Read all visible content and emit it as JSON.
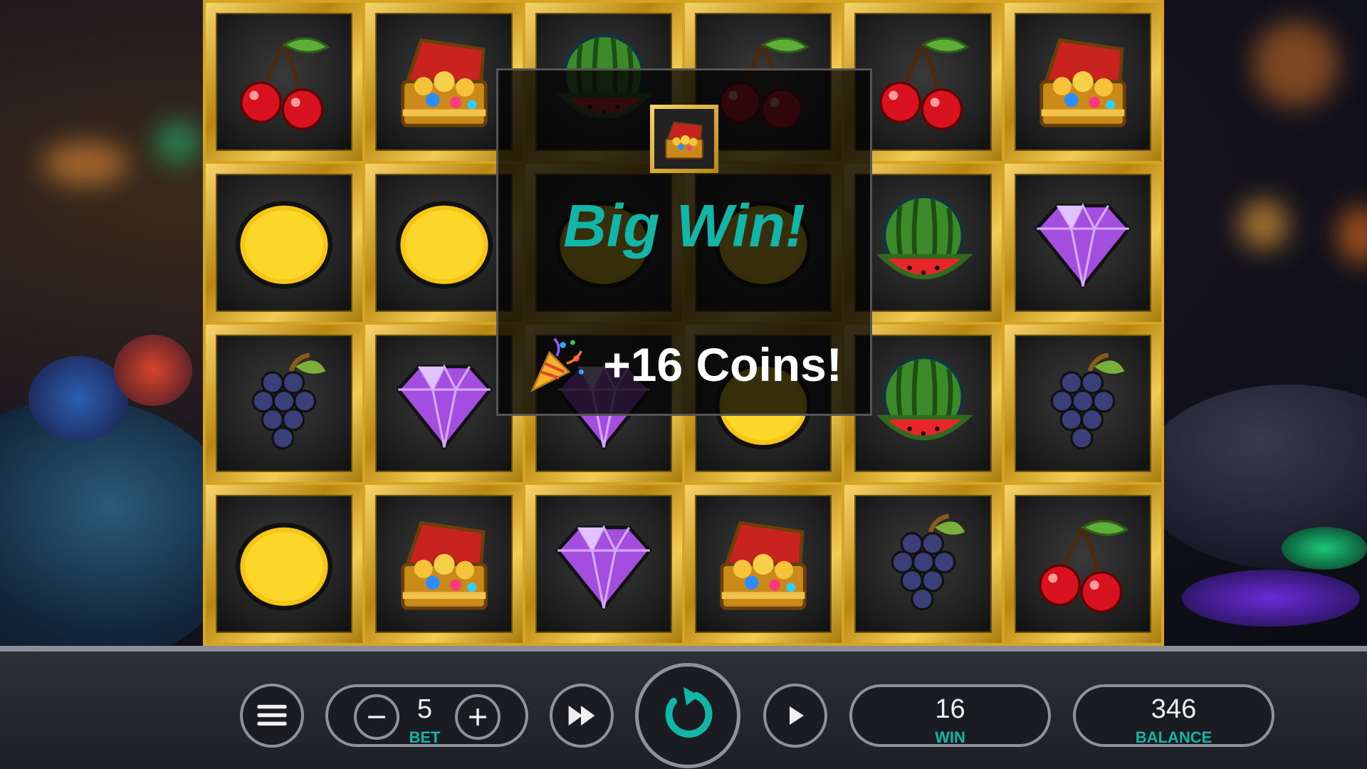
{
  "popup": {
    "title": "Big Win!",
    "prize_text": "+16 Coins!",
    "symbol": "treasure-chest",
    "party_icon": "party-popper-icon"
  },
  "grid": {
    "columns": 6,
    "rows": 4,
    "symbols": [
      [
        "cherry",
        "treasure-chest",
        "watermelon",
        "cherry",
        "cherry",
        "treasure-chest"
      ],
      [
        "lemon",
        "lemon",
        "lemon",
        "lemon",
        "watermelon",
        "diamond"
      ],
      [
        "grapes",
        "diamond",
        "diamond",
        "lemon",
        "watermelon",
        "grapes"
      ],
      [
        "lemon",
        "treasure-chest",
        "diamond",
        "treasure-chest",
        "grapes",
        "cherry"
      ]
    ]
  },
  "controls": {
    "menu_icon": "hamburger-menu-icon",
    "bet": {
      "value": "5",
      "label": "BET"
    },
    "decrease_icon": "minus-icon",
    "increase_icon": "plus-icon",
    "fast_forward_icon": "fast-forward-icon",
    "spin_icon": "spin-refresh-icon",
    "autoplay_icon": "play-icon",
    "win": {
      "value": "16",
      "label": "WIN"
    },
    "balance": {
      "value": "346",
      "label": "BALANCE"
    }
  },
  "colors": {
    "accent": "#12b5a6",
    "gold": "#d4a422",
    "bar": "#1d2027"
  }
}
